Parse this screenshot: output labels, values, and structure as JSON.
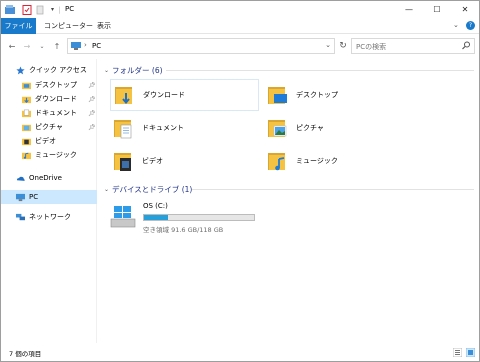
{
  "window": {
    "title": "PC",
    "controls": {
      "minimize": "—",
      "maximize": "☐",
      "close": "✕"
    }
  },
  "ribbon": {
    "tabs": [
      "ファイル",
      "コンピューター",
      "表示"
    ],
    "collapse": "⌄",
    "help": "?"
  },
  "address": {
    "path": "PC",
    "separator": "›",
    "search_placeholder": "PCの検索"
  },
  "sidebar": {
    "items": [
      {
        "label": "クイック アクセス",
        "icon": "star-icon"
      },
      {
        "label": "デスクトップ",
        "icon": "desktop-folder-icon",
        "pinned": true
      },
      {
        "label": "ダウンロード",
        "icon": "download-folder-icon",
        "pinned": true
      },
      {
        "label": "ドキュメント",
        "icon": "documents-folder-icon",
        "pinned": true
      },
      {
        "label": "ピクチャ",
        "icon": "pictures-folder-icon",
        "pinned": true
      },
      {
        "label": "ビデオ",
        "icon": "video-folder-icon"
      },
      {
        "label": "ミュージック",
        "icon": "music-folder-icon"
      },
      {
        "label": "OneDrive",
        "icon": "onedrive-icon"
      },
      {
        "label": "PC",
        "icon": "pc-icon",
        "selected": true
      },
      {
        "label": "ネットワーク",
        "icon": "network-icon"
      }
    ]
  },
  "main": {
    "folders_header": "フォルダー (6)",
    "folders": [
      {
        "label": "ダウンロード",
        "icon": "download-folder-icon",
        "selected": true
      },
      {
        "label": "デスクトップ",
        "icon": "desktop-folder-icon"
      },
      {
        "label": "ドキュメント",
        "icon": "documents-folder-icon"
      },
      {
        "label": "ピクチャ",
        "icon": "pictures-folder-icon"
      },
      {
        "label": "ビデオ",
        "icon": "video-folder-icon"
      },
      {
        "label": "ミュージック",
        "icon": "music-folder-icon"
      }
    ],
    "drives_header": "デバイスとドライブ (1)",
    "drive": {
      "label": "OS (C:)",
      "free_text": "空き領域 91.6 GB/118 GB",
      "used_fraction": 0.22
    }
  },
  "status": {
    "text": "7 個の項目"
  },
  "colors": {
    "accent": "#1979ca",
    "folder": "#f5c242",
    "selection": "#cce8ff",
    "drive_fill": "#26a0da",
    "group_header": "#1e3287"
  }
}
